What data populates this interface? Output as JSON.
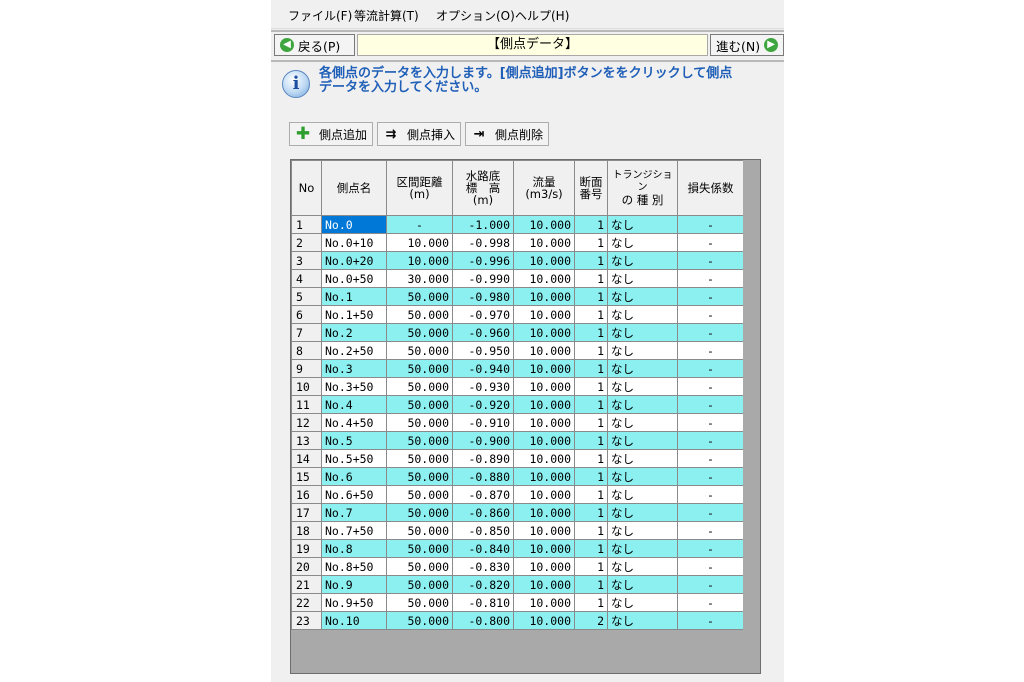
{
  "menu": [
    "ファイル(F)",
    "等流計算(T)",
    "オプション(O)",
    "ヘルプ(H)"
  ],
  "nav": {
    "back": "戻る(P)",
    "title": "【側点データ】",
    "next": "進む(N)"
  },
  "info": {
    "line1": "各側点のデータを入力します。[側点追加]ボタンををクリックして側点",
    "line2": "データを入力してください。"
  },
  "toolbar": {
    "add": "側点追加",
    "insert": "側点挿入",
    "delete": "側点削除"
  },
  "table": {
    "headers": {
      "no": "No",
      "name": "側点名",
      "dist_1": "区間距離",
      "dist_2": "(m)",
      "elev_1": "水路底",
      "elev_2": "標　高",
      "elev_3": "(m)",
      "flow_1": "流量",
      "flow_2": "(m3/s)",
      "sec_1": "断面",
      "sec_2": "番号",
      "trans_1": "トランジション",
      "trans_2": "の 種 別",
      "loss": "損失係数"
    },
    "rows": [
      {
        "no": "1",
        "name": "No.0",
        "dist": "-",
        "elev": "-1.000",
        "flow": "10.000",
        "sec": "1",
        "trans": "なし",
        "loss": "-"
      },
      {
        "no": "2",
        "name": "No.0+10",
        "dist": "10.000",
        "elev": "-0.998",
        "flow": "10.000",
        "sec": "1",
        "trans": "なし",
        "loss": "-"
      },
      {
        "no": "3",
        "name": "No.0+20",
        "dist": "10.000",
        "elev": "-0.996",
        "flow": "10.000",
        "sec": "1",
        "trans": "なし",
        "loss": "-"
      },
      {
        "no": "4",
        "name": "No.0+50",
        "dist": "30.000",
        "elev": "-0.990",
        "flow": "10.000",
        "sec": "1",
        "trans": "なし",
        "loss": "-"
      },
      {
        "no": "5",
        "name": "No.1",
        "dist": "50.000",
        "elev": "-0.980",
        "flow": "10.000",
        "sec": "1",
        "trans": "なし",
        "loss": "-"
      },
      {
        "no": "6",
        "name": "No.1+50",
        "dist": "50.000",
        "elev": "-0.970",
        "flow": "10.000",
        "sec": "1",
        "trans": "なし",
        "loss": "-"
      },
      {
        "no": "7",
        "name": "No.2",
        "dist": "50.000",
        "elev": "-0.960",
        "flow": "10.000",
        "sec": "1",
        "trans": "なし",
        "loss": "-"
      },
      {
        "no": "8",
        "name": "No.2+50",
        "dist": "50.000",
        "elev": "-0.950",
        "flow": "10.000",
        "sec": "1",
        "trans": "なし",
        "loss": "-"
      },
      {
        "no": "9",
        "name": "No.3",
        "dist": "50.000",
        "elev": "-0.940",
        "flow": "10.000",
        "sec": "1",
        "trans": "なし",
        "loss": "-"
      },
      {
        "no": "10",
        "name": "No.3+50",
        "dist": "50.000",
        "elev": "-0.930",
        "flow": "10.000",
        "sec": "1",
        "trans": "なし",
        "loss": "-"
      },
      {
        "no": "11",
        "name": "No.4",
        "dist": "50.000",
        "elev": "-0.920",
        "flow": "10.000",
        "sec": "1",
        "trans": "なし",
        "loss": "-"
      },
      {
        "no": "12",
        "name": "No.4+50",
        "dist": "50.000",
        "elev": "-0.910",
        "flow": "10.000",
        "sec": "1",
        "trans": "なし",
        "loss": "-"
      },
      {
        "no": "13",
        "name": "No.5",
        "dist": "50.000",
        "elev": "-0.900",
        "flow": "10.000",
        "sec": "1",
        "trans": "なし",
        "loss": "-"
      },
      {
        "no": "14",
        "name": "No.5+50",
        "dist": "50.000",
        "elev": "-0.890",
        "flow": "10.000",
        "sec": "1",
        "trans": "なし",
        "loss": "-"
      },
      {
        "no": "15",
        "name": "No.6",
        "dist": "50.000",
        "elev": "-0.880",
        "flow": "10.000",
        "sec": "1",
        "trans": "なし",
        "loss": "-"
      },
      {
        "no": "16",
        "name": "No.6+50",
        "dist": "50.000",
        "elev": "-0.870",
        "flow": "10.000",
        "sec": "1",
        "trans": "なし",
        "loss": "-"
      },
      {
        "no": "17",
        "name": "No.7",
        "dist": "50.000",
        "elev": "-0.860",
        "flow": "10.000",
        "sec": "1",
        "trans": "なし",
        "loss": "-"
      },
      {
        "no": "18",
        "name": "No.7+50",
        "dist": "50.000",
        "elev": "-0.850",
        "flow": "10.000",
        "sec": "1",
        "trans": "なし",
        "loss": "-"
      },
      {
        "no": "19",
        "name": "No.8",
        "dist": "50.000",
        "elev": "-0.840",
        "flow": "10.000",
        "sec": "1",
        "trans": "なし",
        "loss": "-"
      },
      {
        "no": "20",
        "name": "No.8+50",
        "dist": "50.000",
        "elev": "-0.830",
        "flow": "10.000",
        "sec": "1",
        "trans": "なし",
        "loss": "-"
      },
      {
        "no": "21",
        "name": "No.9",
        "dist": "50.000",
        "elev": "-0.820",
        "flow": "10.000",
        "sec": "1",
        "trans": "なし",
        "loss": "-"
      },
      {
        "no": "22",
        "name": "No.9+50",
        "dist": "50.000",
        "elev": "-0.810",
        "flow": "10.000",
        "sec": "1",
        "trans": "なし",
        "loss": "-"
      },
      {
        "no": "23",
        "name": "No.10",
        "dist": "50.000",
        "elev": "-0.800",
        "flow": "10.000",
        "sec": "2",
        "trans": "なし",
        "loss": "-"
      }
    ]
  },
  "colors": {
    "row_alt": "#8cf0f0",
    "selection": "#0078d7",
    "info_text": "#1f5fb8",
    "title_bg": "#ffffe1"
  }
}
